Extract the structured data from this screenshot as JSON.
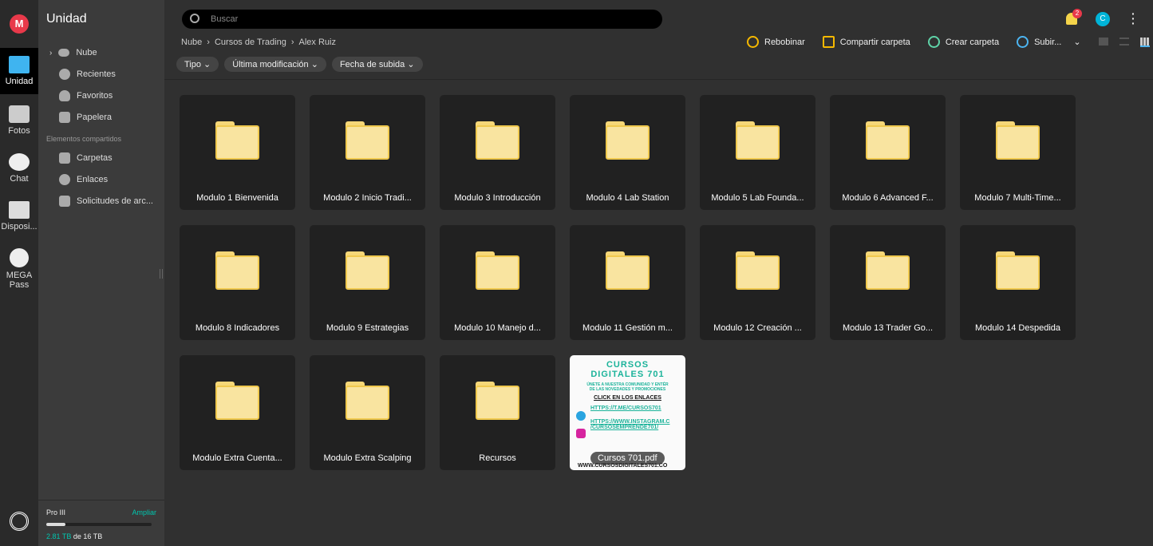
{
  "rail": {
    "logo": "M",
    "items": [
      {
        "label": "Unidad",
        "icon": "folder-icon"
      },
      {
        "label": "Fotos",
        "icon": "photos-icon"
      },
      {
        "label": "Chat",
        "icon": "chat-icon"
      },
      {
        "label": "Disposi...",
        "icon": "devices-icon"
      },
      {
        "label": "MEGA Pass",
        "icon": "keyhole-icon"
      }
    ]
  },
  "sidebar": {
    "title": "Unidad",
    "items": [
      {
        "label": "Nube"
      },
      {
        "label": "Recientes"
      },
      {
        "label": "Favoritos"
      },
      {
        "label": "Papelera"
      }
    ],
    "shared_title": "Elementos compartidos",
    "shared": [
      {
        "label": "Carpetas"
      },
      {
        "label": "Enlaces"
      },
      {
        "label": "Solicitudes de arc..."
      }
    ],
    "storage": {
      "plan": "Pro III",
      "upgrade": "Ampliar",
      "used": "2.81 TB",
      "of": "de",
      "total": "16 TB",
      "fraction": 0.18
    }
  },
  "header": {
    "search_placeholder": "Buscar",
    "notifications": "2",
    "avatar": "C"
  },
  "breadcrumb": [
    "Nube",
    "Cursos de Trading",
    "Alex Ruiz"
  ],
  "filters": [
    "Tipo",
    "Última modificación",
    "Fecha de subida"
  ],
  "toolbar": {
    "rewind": "Rebobinar",
    "share": "Compartir carpeta",
    "create": "Crear carpeta",
    "upload": "Subir..."
  },
  "colors": {
    "accent": "#00c5ae",
    "folder": "#f9e4a0",
    "badge": "#e8394a"
  },
  "items": [
    "Modulo 1 Bienvenida",
    "Modulo 2 Inicio Tradi...",
    "Modulo 3 Introducción",
    "Modulo 4 Lab Station",
    "Modulo 5 Lab Founda...",
    "Modulo 6 Advanced F...",
    "Modulo 7 Multi-Time...",
    "Modulo 8 Indicadores",
    "Modulo 9 Estrategias",
    "Modulo 10 Manejo d...",
    "Modulo 11 Gestión m...",
    "Modulo 12 Creación ...",
    "Modulo 13 Trader Go...",
    "Modulo 14 Despedida",
    "Modulo Extra Cuenta...",
    "Modulo Extra Scalping",
    "Recursos"
  ],
  "file": {
    "name": "Cursos 701.pdf",
    "thumb": {
      "title1": "CURSOS",
      "title2": "DIGITALES 701",
      "line1": "ÚNETE A NUESTRA COMUNIDAD Y ENTÉR",
      "line2": "DE LAS NOVEDADES Y PROMOCIONES",
      "cta": "CLICK EN LOS ENLACES",
      "link1": "HTTPS://T.ME/CURSOS701",
      "link2": "HTTPS://WWW.INSTAGRAM.C",
      "link3": "/CURSOSEMPRENDE701/",
      "footer": "WWW.CURSOSDIGITALES701.CO"
    }
  }
}
